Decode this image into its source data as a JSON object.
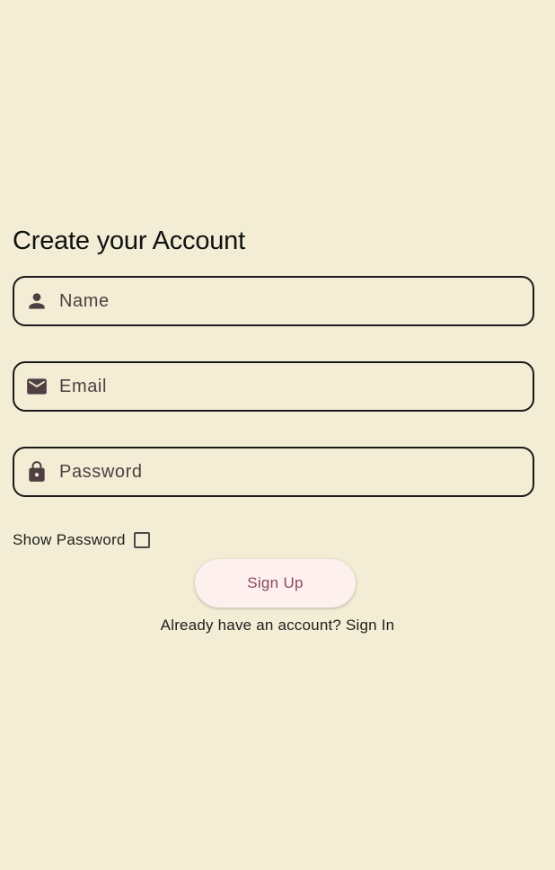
{
  "form": {
    "title": "Create your Account",
    "fields": {
      "name": {
        "placeholder": "Name",
        "value": "",
        "icon": "person-icon"
      },
      "email": {
        "placeholder": "Email",
        "value": "",
        "icon": "mail-icon"
      },
      "password": {
        "placeholder": "Password",
        "value": "",
        "icon": "lock-icon"
      }
    },
    "show_password": {
      "label": "Show Password",
      "checked": false
    },
    "submit_label": "Sign Up",
    "signin_prompt": "Already have an account?",
    "signin_link": "Sign In"
  },
  "colors": {
    "background": "#f2edd4",
    "field_border": "#1a1a1a",
    "icon": "#4f3f42",
    "button_bg": "#fdf0ee",
    "button_text": "#8a4a5f"
  }
}
